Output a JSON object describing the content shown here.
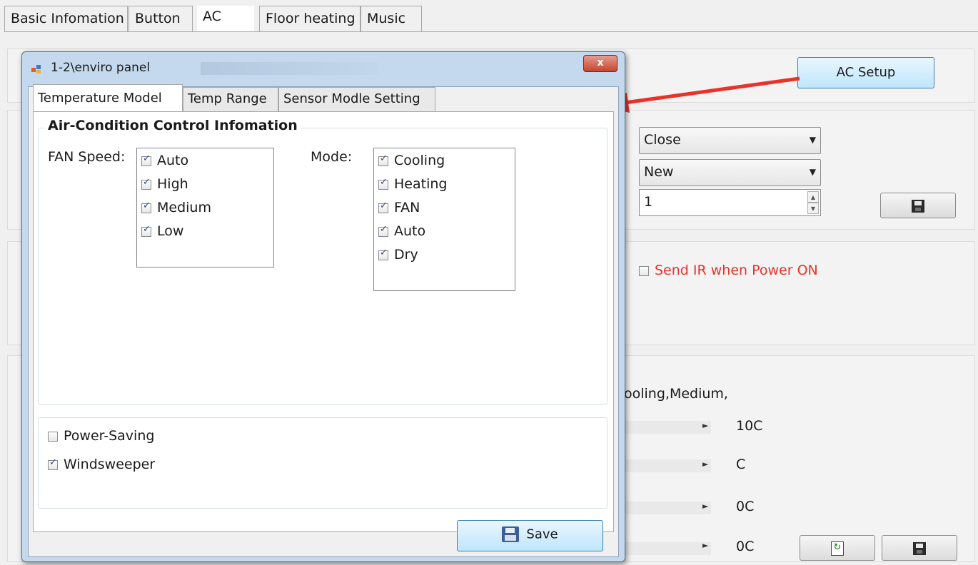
{
  "main_tabs": [
    "Basic Infomation",
    "Button",
    "AC",
    "Floor heating",
    "Music"
  ],
  "ac_setup_button": "AC Setup",
  "combo_close": "Close",
  "combo_new": "New",
  "spin_value": "1",
  "send_ir_label": "Send IR when Power ON",
  "status_text": "ooling,Medium,",
  "temp_values": [
    "10C",
    "C",
    "0C",
    "0C"
  ],
  "dialog": {
    "title": "1-2\\enviro panel",
    "close_glyph": "x",
    "tabs": [
      "Temperature Model",
      "Temp Range",
      "Sensor Modle Setting"
    ],
    "group_title": "Air-Condition Control Infomation",
    "fan_label": "FAN Speed:",
    "fan_items": [
      "Auto",
      "High",
      "Medium",
      "Low"
    ],
    "mode_label": "Mode:",
    "mode_items": [
      "Cooling",
      "Heating",
      "FAN",
      "Auto",
      "Dry"
    ],
    "power_saving": "Power-Saving",
    "windsweeper": "Windsweeper",
    "save_button": "Save"
  },
  "colors": {
    "accent_red": "#e8332a",
    "button_blue": "#3c7fb1",
    "dialog_frame": "#c4d9ee"
  }
}
